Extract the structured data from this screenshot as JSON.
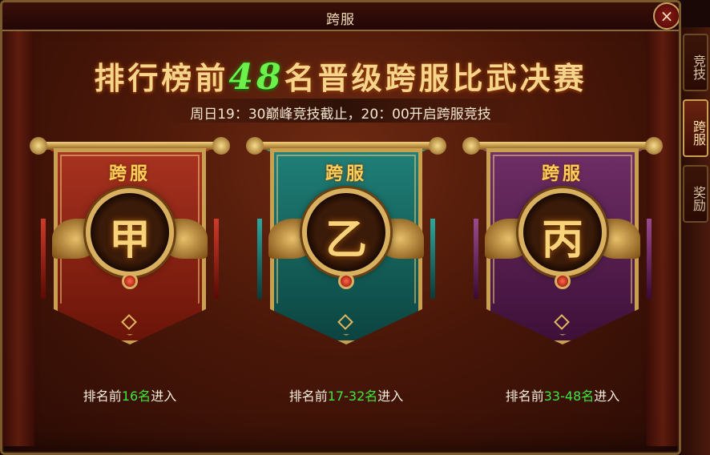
{
  "window": {
    "title": "跨服",
    "close_label": "×"
  },
  "headline": {
    "prefix": "排行榜前",
    "number": "48",
    "mid": "名",
    "suffix": "晋级跨服比武决赛"
  },
  "subtitle": "周日19：30巅峰竞技截止，20：00开启跨服竞技",
  "banners": [
    {
      "tag": "跨服",
      "char": "甲",
      "rank_prefix": "排名前",
      "rank_num": "16名",
      "rank_suffix": "进入",
      "color": "#8a2414",
      "sash": "#d03a2a"
    },
    {
      "tag": "跨服",
      "char": "乙",
      "rank_prefix": "排名前",
      "rank_num": "17-32名",
      "rank_suffix": "进入",
      "color": "#1c6a66",
      "sash": "#2aa8a0"
    },
    {
      "tag": "跨服",
      "char": "丙",
      "rank_prefix": "排名前",
      "rank_num": "33-48名",
      "rank_suffix": "进入",
      "color": "#5a2450",
      "sash": "#9a4a90"
    }
  ],
  "side_tabs": [
    {
      "label": "竞技",
      "active": false
    },
    {
      "label": "跨服",
      "active": true
    },
    {
      "label": "奖励",
      "active": false
    }
  ],
  "colors": {
    "accent_green": "#3ce83a",
    "gold": "#d9b060"
  }
}
